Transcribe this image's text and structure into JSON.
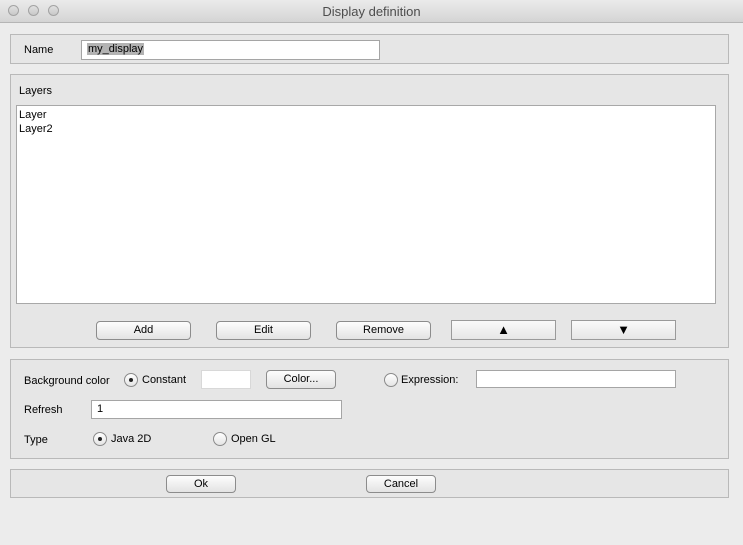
{
  "window": {
    "title": "Display definition"
  },
  "name": {
    "label": "Name",
    "value": "my_display"
  },
  "layers": {
    "label": "Layers",
    "items": [
      "Layer",
      "Layer2"
    ],
    "buttons": {
      "add": "Add",
      "edit": "Edit",
      "remove": "Remove",
      "up": "▲",
      "down": "▼"
    }
  },
  "settings": {
    "background_label": "Background color",
    "constant_label": "Constant",
    "color_button": "Color...",
    "expression_label": "Expression:",
    "expression_value": "",
    "refresh_label": "Refresh",
    "refresh_value": "1",
    "type_label": "Type",
    "type_java2d": "Java 2D",
    "type_opengl": "Open GL",
    "background_mode": "Constant",
    "type_selected": "Java 2D"
  },
  "footer": {
    "ok": "Ok",
    "cancel": "Cancel"
  }
}
